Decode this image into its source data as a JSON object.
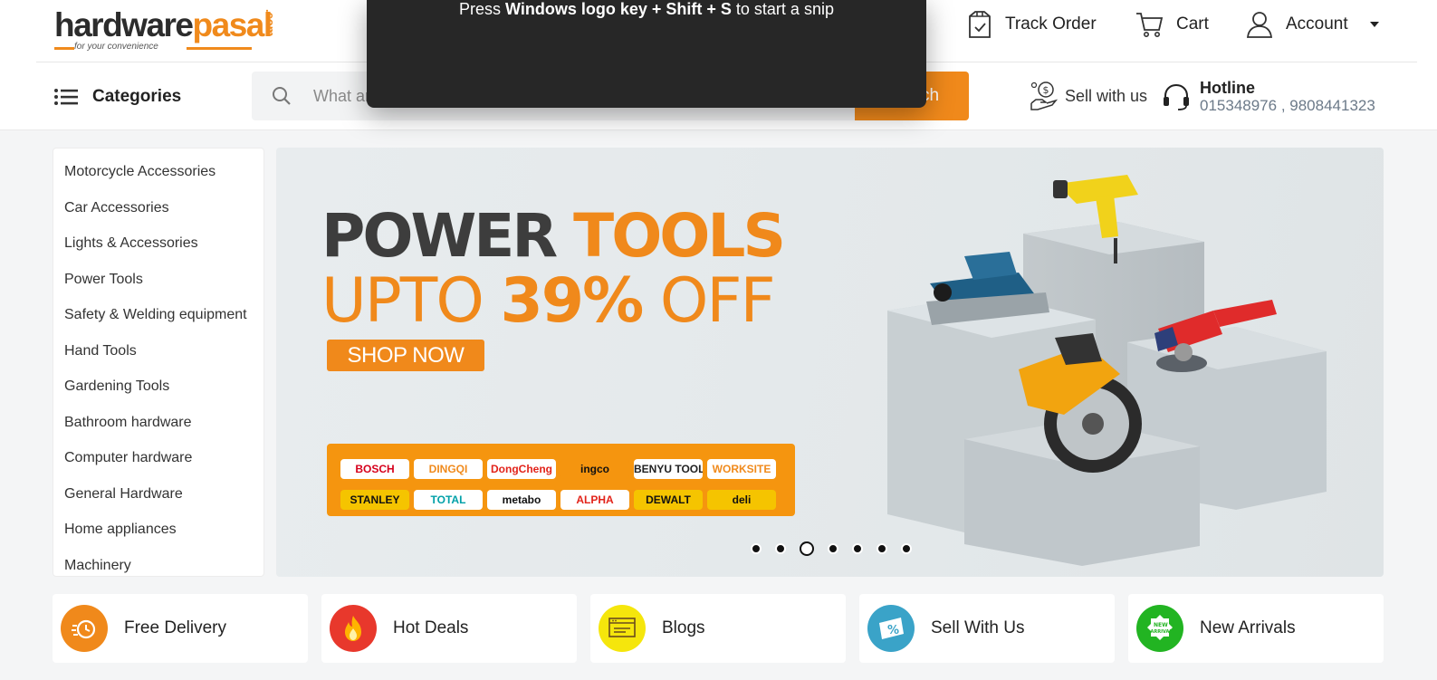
{
  "header": {
    "logo": {
      "word_dark": "hardware",
      "word_orange": "pasal",
      "com": ".com",
      "tagline": "for your convenience"
    },
    "nav": {
      "track_order": "Track Order",
      "cart": "Cart",
      "account": "Account",
      "partial_hidden": "t"
    }
  },
  "subheader": {
    "categories_label": "Categories",
    "search": {
      "placeholder": "What are you looking for?",
      "button": "Search"
    },
    "sell_label": "Sell with us",
    "hotline": {
      "title": "Hotline",
      "numbers": "015348976 , 9808441323"
    }
  },
  "sidebar": {
    "items": [
      "Motorcycle Accessories",
      "Car Accessories",
      "Lights & Accessories",
      "Power Tools",
      "Safety & Welding equipment",
      "Hand Tools",
      "Gardening Tools",
      "Bathroom hardware",
      "Computer hardware",
      "General Hardware",
      "Home appliances",
      "Machinery"
    ]
  },
  "banner": {
    "line1_dark": "POWER ",
    "line1_orange": "TOOLS",
    "line2_a": "UPTO ",
    "line2_bold": "39%",
    "line2_b": " OFF",
    "cta": "SHOP NOW",
    "brands": [
      {
        "name": "BOSCH",
        "color": "#d6001c"
      },
      {
        "name": "DINGQI",
        "color": "#f08a1c"
      },
      {
        "name": "DongCheng",
        "color": "#e2231a"
      },
      {
        "name": "ingco",
        "color": "#111111"
      },
      {
        "name": "BENYU TOOLS",
        "color": "#222222"
      },
      {
        "name": "WORKSITE",
        "color": "#f08a1c"
      },
      {
        "name": "STANLEY",
        "color": "#111111"
      },
      {
        "name": "TOTAL",
        "color": "#00a0a8"
      },
      {
        "name": "metabo",
        "color": "#111111"
      },
      {
        "name": "ALPHA",
        "color": "#e2231a"
      },
      {
        "name": "DEWALT",
        "color": "#111111"
      },
      {
        "name": "deli",
        "color": "#111111"
      }
    ],
    "slides_total": 7,
    "active_slide": 3
  },
  "features": [
    {
      "label": "Free Delivery",
      "icon": "delivery-icon",
      "color": "#f0891b"
    },
    {
      "label": "Hot Deals",
      "icon": "fire-icon",
      "color": "#e8382c"
    },
    {
      "label": "Blogs",
      "icon": "blog-icon",
      "color": "#f5e60c"
    },
    {
      "label": "Sell With Us",
      "icon": "percent-tag-icon",
      "color": "#3aa3c8"
    },
    {
      "label": "New Arrivals",
      "icon": "new-badge-icon",
      "color": "#22b422"
    }
  ],
  "overlay": {
    "press": "Press ",
    "keys": "Windows logo key + Shift + S",
    "rest": " to start a snip"
  }
}
